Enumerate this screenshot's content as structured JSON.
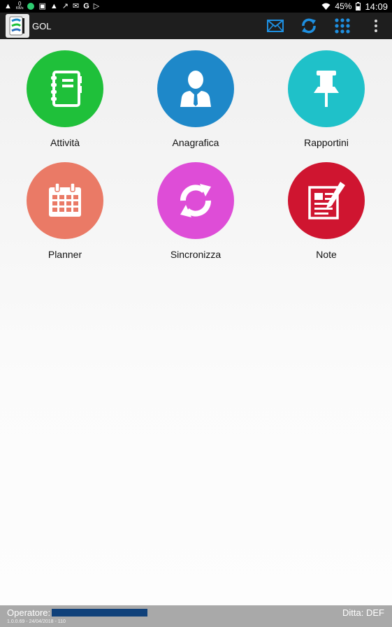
{
  "status_bar": {
    "kbs_value": "0",
    "kbs_unit": "KB/s",
    "battery": "45%",
    "time": "14:09",
    "left_icons": [
      "warning-icon",
      "green-dot-icon",
      "image-icon",
      "warning-icon",
      "missed-call-icon",
      "gmail-icon",
      "google-icon",
      "play-store-icon"
    ],
    "right_icons": [
      "wifi-icon",
      "battery-icon"
    ]
  },
  "app_bar": {
    "title": "GOL",
    "actions": [
      "mail-icon",
      "sync-icon",
      "apps-grid-icon",
      "overflow-menu-icon"
    ]
  },
  "menu": [
    {
      "label": "Attività",
      "color": "#1fc03a",
      "icon": "notebook-icon"
    },
    {
      "label": "Anagrafica",
      "color": "#1e88c9",
      "icon": "person-icon"
    },
    {
      "label": "Rapportini",
      "color": "#1fc1c9",
      "icon": "pushpin-icon"
    },
    {
      "label": "Planner",
      "color": "#ea7a66",
      "icon": "calendar-icon"
    },
    {
      "label": "Sincronizza",
      "color": "#de4dd7",
      "icon": "sync-arrows-icon"
    },
    {
      "label": "Note",
      "color": "#cf1530",
      "icon": "note-pencil-icon"
    }
  ],
  "footer": {
    "operator_label": "Operatore:",
    "ditta": "Ditta: DEF",
    "version": "1.0.0.69 - 24/04/2018 - 110"
  }
}
